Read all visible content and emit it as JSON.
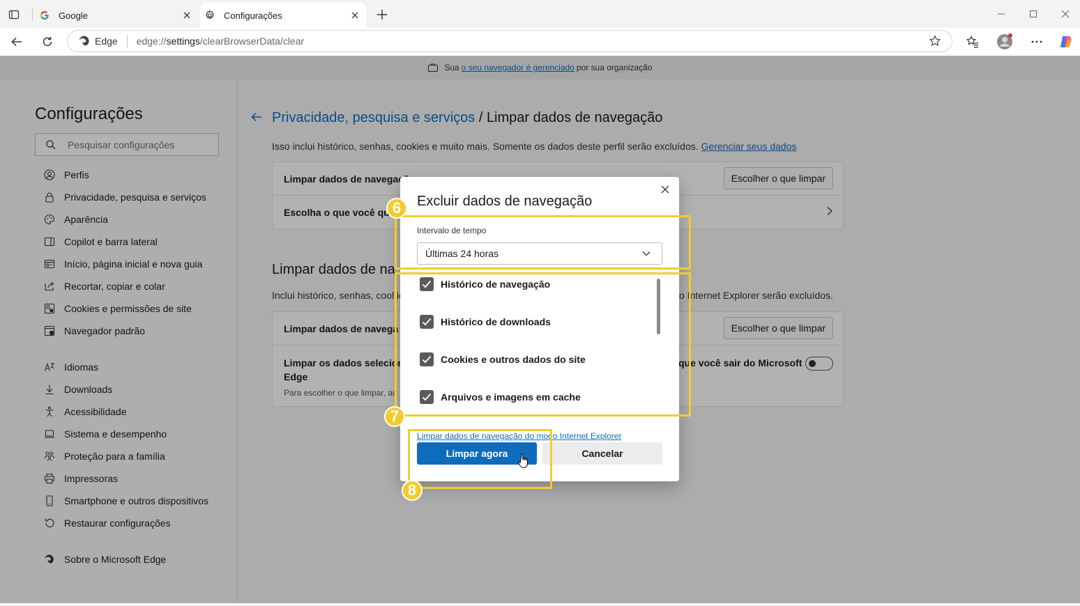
{
  "tabs": [
    {
      "title": "Google",
      "icon": "google-icon"
    },
    {
      "title": "Configurações",
      "icon": "gear-icon"
    }
  ],
  "address": {
    "brand": "Edge",
    "url_prefix": "edge://",
    "url_host": "settings",
    "url_path": "/clearBrowserData/clear"
  },
  "managed": {
    "pre": "Sua",
    "link": "o seu navegador é gerenciado",
    "post": "por sua organização"
  },
  "sidebar": {
    "title": "Configurações",
    "search_placeholder": "Pesquisar configurações",
    "items": [
      {
        "label": "Perfis",
        "icon": "profile-icon"
      },
      {
        "label": "Privacidade, pesquisa e serviços",
        "icon": "lock-icon"
      },
      {
        "label": "Aparência",
        "icon": "appearance-icon"
      },
      {
        "label": "Copilot e barra lateral",
        "icon": "sidebar-icon"
      },
      {
        "label": "Início, página inicial e nova guia",
        "icon": "home-icon"
      },
      {
        "label": "Recortar, copiar e colar",
        "icon": "share-icon"
      },
      {
        "label": "Cookies e permissões de site",
        "icon": "cookie-icon"
      },
      {
        "label": "Navegador padrão",
        "icon": "browser-icon"
      },
      {
        "label": "Idiomas",
        "icon": "language-icon"
      },
      {
        "label": "Downloads",
        "icon": "download-icon"
      },
      {
        "label": "Acessibilidade",
        "icon": "accessibility-icon"
      },
      {
        "label": "Sistema e desempenho",
        "icon": "laptop-icon"
      },
      {
        "label": "Proteção para a família",
        "icon": "family-icon"
      },
      {
        "label": "Impressoras",
        "icon": "printer-icon"
      },
      {
        "label": "Smartphone e outros dispositivos",
        "icon": "phone-icon"
      },
      {
        "label": "Restaurar configurações",
        "icon": "reset-icon"
      },
      {
        "label": "Sobre o Microsoft Edge",
        "icon": "edge-icon"
      }
    ]
  },
  "main": {
    "breadcrumb_link": "Privacidade, pesquisa e serviços",
    "breadcrumb_sep": " / ",
    "breadcrumb_current": "Limpar dados de navegação",
    "description": "Isso inclui histórico, senhas, cookies e muito mais. Somente os dados deste perfil serão excluídos.",
    "manage_link": "Gerenciar seus dados",
    "card1": {
      "row1_label": "Limpar dados de navegaçã",
      "row1_button": "Escolher o que limpar",
      "row2_label": "Escolha o que você que"
    },
    "section_title": "Limpar dados de na",
    "section_desc_left": "Inclui histórico, senhas, cool ie",
    "section_desc_right": "o Internet Explorer serão excluídos.",
    "card2": {
      "row1_label": "Limpar dados de navega",
      "row1_button": "Escolher o que limpar",
      "row2_label_line1": "Limpar os dados selecior a",
      "row2_label_right": "que você sair do Microsoft",
      "row2_label_line2": "Edge",
      "row2_sub": "Para escolher o que limpar, ac"
    }
  },
  "modal": {
    "title": "Excluir dados de navegação",
    "range_label": "Intervalo de tempo",
    "range_value": "Últimas 24 horas",
    "checkboxes": [
      {
        "label": "Histórico de navegação",
        "checked": true
      },
      {
        "label": "Histórico de downloads",
        "checked": true
      },
      {
        "label": "Cookies e outros dados do site",
        "checked": true
      },
      {
        "label": "Arquivos e imagens em cache",
        "checked": true
      }
    ],
    "ie_link": "Limpar dados de navegação do modo Internet Explorer",
    "primary_button": "Limpar agora",
    "secondary_button": "Cancelar"
  },
  "annotations": {
    "badge6": "6",
    "badge7": "7",
    "badge8": "8",
    "color": "#f2cd2a"
  },
  "colors": {
    "accent": "#0f6cbd",
    "highlight": "#f2cd2a"
  }
}
